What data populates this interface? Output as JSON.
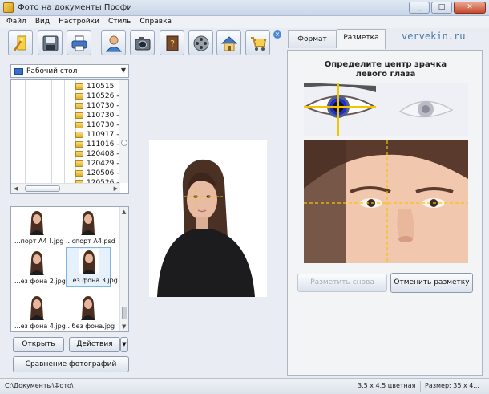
{
  "window": {
    "title": "Фото на документы Профи",
    "minimize": "_",
    "maximize": "□",
    "close": "✕"
  },
  "menu": [
    "Файл",
    "Вид",
    "Настройки",
    "Стиль",
    "Справка"
  ],
  "toolbar": {
    "buttons": [
      "wizard",
      "save",
      "print",
      "user",
      "camera",
      "help",
      "video",
      "home",
      "shop"
    ],
    "close": "×"
  },
  "left": {
    "folder": "Рабочий стол",
    "tree": [
      "110515",
      "110526 -",
      "110730 -",
      "110730 -",
      "110730 -",
      "110917 -",
      "111016 -",
      "120408 -",
      "120429 -",
      "120506 -",
      "120526 -"
    ],
    "thumbnails": [
      "...порт А4 !.jpg",
      "...спорт А4.psd",
      "...ез фона 2.jpg",
      "...ез фона 3.jpg",
      "...ез фона 4.jpg",
      "...без фона.jpg"
    ],
    "selected_thumb": 3,
    "open_button": "Открыть",
    "actions_button": "Действия",
    "dropdown_arrow": "▼",
    "compare_button": "Сравнение фотографий"
  },
  "right": {
    "tabs": [
      "Формат",
      "Разметка"
    ],
    "active_tab": 1,
    "watermark": "vervekin.ru",
    "instruction_line1": "Определите центр зрачка",
    "instruction_line2": "левого глаза",
    "mark_again_button": "Разметить снова",
    "cancel_markup_button": "Отменить разметку"
  },
  "status": {
    "path": "C:\\Документы\\Фото\\",
    "format": "3.5 x 4.5 цветная",
    "size": "Размер: 35 x 4..."
  }
}
